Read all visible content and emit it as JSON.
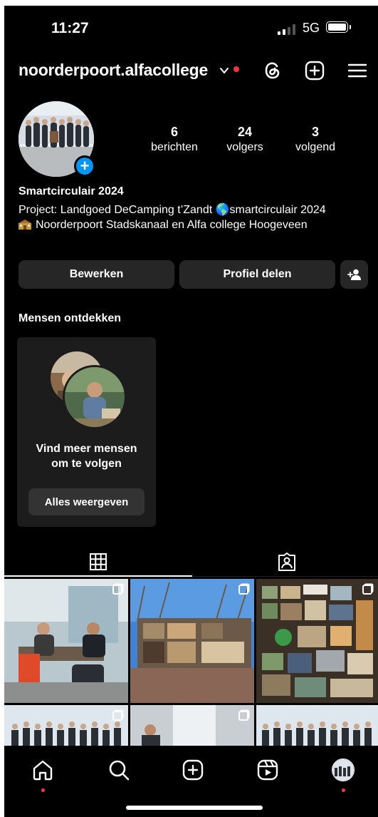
{
  "status_bar": {
    "time": "11:27",
    "network": "5G"
  },
  "header": {
    "username": "noorderpoort.alfacollege",
    "icons": [
      "chevron-down-icon",
      "threads-icon",
      "add-post-icon",
      "menu-icon"
    ]
  },
  "profile": {
    "stats": [
      {
        "value": "6",
        "label": "berichten"
      },
      {
        "value": "24",
        "label": "volgers"
      },
      {
        "value": "3",
        "label": "volgend"
      }
    ],
    "name": "Smartcirculair 2024",
    "bio_line1": "Project: Landgoed DeCamping t’Zandt 🌎smartcirculair 2024",
    "bio_line2": "Noorderpoort Stadskanaal en Alfa college Hoogeveen",
    "bio_icon": "school-icon"
  },
  "actions": {
    "edit": "Bewerken",
    "share": "Profiel delen",
    "discover_icon": "add-person-icon"
  },
  "discover": {
    "title": "Mensen ontdekken",
    "card_text_line1": "Vind meer mensen",
    "card_text_line2": "om te volgen",
    "card_button": "Alles weergeven"
  },
  "tabs": [
    {
      "icon": "grid-icon",
      "active": true
    },
    {
      "icon": "tagged-icon",
      "active": false
    }
  ],
  "nav": [
    "home-icon",
    "search-icon",
    "create-icon",
    "reels-icon",
    "profile-avatar"
  ],
  "colors": {
    "background": "#000000",
    "button": "#262626",
    "accent": "#0095f6",
    "notification": "#ff3040"
  }
}
